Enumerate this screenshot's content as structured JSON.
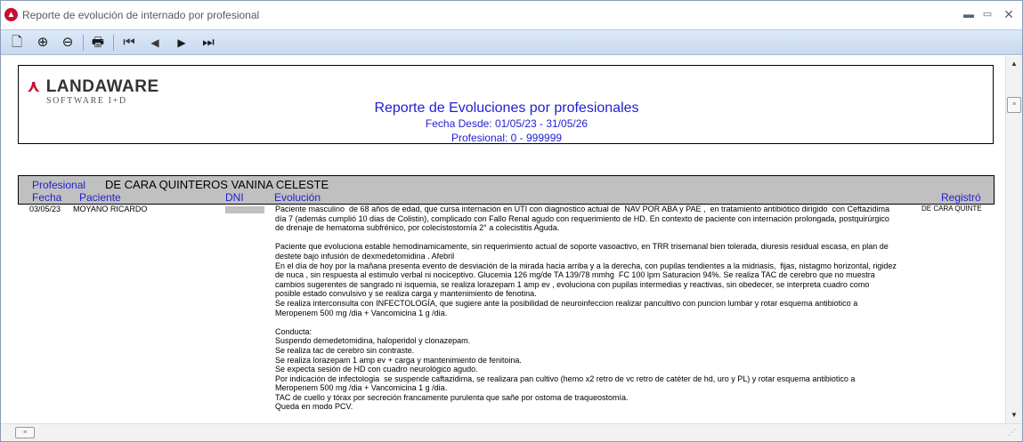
{
  "window": {
    "title": "Reporte de evolución de internado por profesional",
    "app_icon": "landaware-app-icon",
    "controls": {
      "minimize": "▬",
      "maximize": "▭",
      "close": "✕"
    }
  },
  "toolbar": {
    "buttons": [
      {
        "name": "page-setup-icon",
        "glyph": "🗋"
      },
      {
        "name": "zoom-in-icon",
        "glyph": "⊕"
      },
      {
        "name": "zoom-out-icon",
        "glyph": "⊖"
      },
      {
        "name": "print-icon",
        "glyph": "🖶"
      },
      {
        "name": "first-page-icon",
        "glyph": "⏮"
      },
      {
        "name": "previous-page-icon",
        "glyph": "◀"
      },
      {
        "name": "next-page-icon",
        "glyph": "▶"
      },
      {
        "name": "last-page-icon",
        "glyph": "⏭"
      }
    ]
  },
  "report": {
    "logo": {
      "main": "LANDAWARE",
      "sub": "SOFTWARE I+D",
      "brand_color": "#c8102e"
    },
    "title": "Reporte de Evoluciones por profesionales",
    "date_range": "Fecha Desde: 01/05/23 - 31/05/26",
    "professional_range": "Profesional: 0 - 999999",
    "professional_label": "Profesional",
    "professional_name": "DE CARA QUINTEROS VANINA CELESTE",
    "columns": {
      "fecha": "Fecha",
      "paciente": "Paciente",
      "dni": "DNI",
      "evolucion": "Evolución",
      "registro": "Registró"
    },
    "rows": [
      {
        "fecha": "03/05/23",
        "paciente": "MOYANO RICARDO",
        "dni": "",
        "registro": "DE CARA QUINTE",
        "evolucion": "Paciente masculino  de 68 años de edad, que cursa internación en UTI con diagnostico actual de  NAV POR ABA y PAE ,  en tratamiento antibiótico dirigido  con Ceftazidima\ndía 7 (además cumplió 10 dias de Colistin), complicado con Fallo Renal agudo con requerimiento de HD. En contexto de paciente con internación prolongada, postquirúrgico\nde drenaje de hematoma subfrénico, por colecistostomía 2° a colecistitis Aguda.\n\nPaciente que evoluciona estable hemodinamicamente, sin requerimiento actual de soporte vasoactivo, en TRR trisemanal bien tolerada, diuresis residual escasa, en plan de\ndestete bajo infusión de dexmedetomidina . Afebril\nEn el día de hoy por la mañana presenta evento de desviación de la mirada hacia arriba y a la derecha, con pupilas tendientes a la midriasis,  fijas, nistagmo horizontal, rigidez\nde nuca , sin respuesta al estimulo verbal ni nociceptivo. Glucemia 126 mg/de TA 139/78 mmhg  FC 100 lpm Saturacion 94%. Se realiza TAC de cerebro que no muestra\ncambios sugerentes de sangrado ni isquemia, se realiza lorazepam 1 amp ev , evoluciona con pupilas intermedias y reactivas, sin obedecer, se interpreta cuadro como\nposible estado convulsivo y se realiza carga y mantenimiento de fenotina.\nSe realiza interconsulta con INFECTOLOGÍA, que sugiere ante la posibilidad de neuroinfeccion realizar pancultivo con puncion lumbar y rotar esquema antibiotico a\nMeropenem 500 mg /dia + Vancomicina 1 g /dia.\n\nConducta:\nSuspendo demedetomidina, haloperidol y clonazepam.\nSe realiza tac de cerebro sin contraste.\nSe realiza lorazepam 1 amp ev + carga y mantenimiento de fenitoina.\nSe expecta sesión de HD con cuadro neurológico agudo.\nPor indicación de infectologia  se suspende caftazidima, se realizara pan cultivo (hemo x2 retro de vc retro de catéter de hd, uro y PL) y rotar esquema antibiotico a\nMeropenem 500 mg /dia + Vancomicina 1 g /dia.\nTAC de cuello y tórax por secreción francamente purulenta que sañe por ostoma de traqueostomía.\nQueda en modo PCV."
      }
    ]
  },
  "scrollbars": {
    "up": "▲",
    "down": "▼",
    "thumb_grip": "≡",
    "resize_grip": "⋰"
  }
}
